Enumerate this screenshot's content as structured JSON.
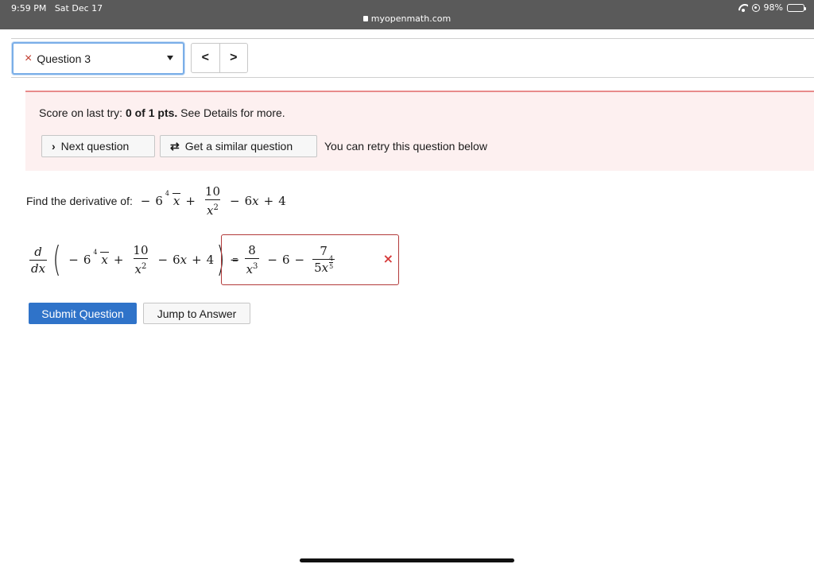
{
  "status_bar": {
    "time": "9:59 PM",
    "date": "Sat Dec 17",
    "url": "myopenmath.com",
    "battery": "98%"
  },
  "question_nav": {
    "selected": "Question 3",
    "status_icon": "×",
    "prev_label": "<",
    "next_label": ">"
  },
  "score": {
    "prefix": "Score on last try: ",
    "value": "0 of 1 pts.",
    "suffix": " See Details for more.",
    "next_question_label": "Next question",
    "similar_question_label": "Get a similar question",
    "retry_note": "You can retry this question below"
  },
  "question": {
    "prompt": "Find the derivative of:",
    "coef_root": "6",
    "root_index": "4",
    "var": "x",
    "frac_num": "10",
    "frac_den_exp": "2",
    "linear_coef": "6",
    "constant": "4"
  },
  "derivative": {
    "d_num": "d",
    "d_den": "dx",
    "equals": "="
  },
  "answer": {
    "num1": "8",
    "den1_exp": "3",
    "mid": "6",
    "num2": "7",
    "den2_coef": "5",
    "den2_exp_num": "4",
    "den2_exp_den": "5",
    "status": "×",
    "status_color": "#d63b3b"
  },
  "actions": {
    "submit_label": "Submit Question",
    "jump_label": "Jump to Answer"
  }
}
